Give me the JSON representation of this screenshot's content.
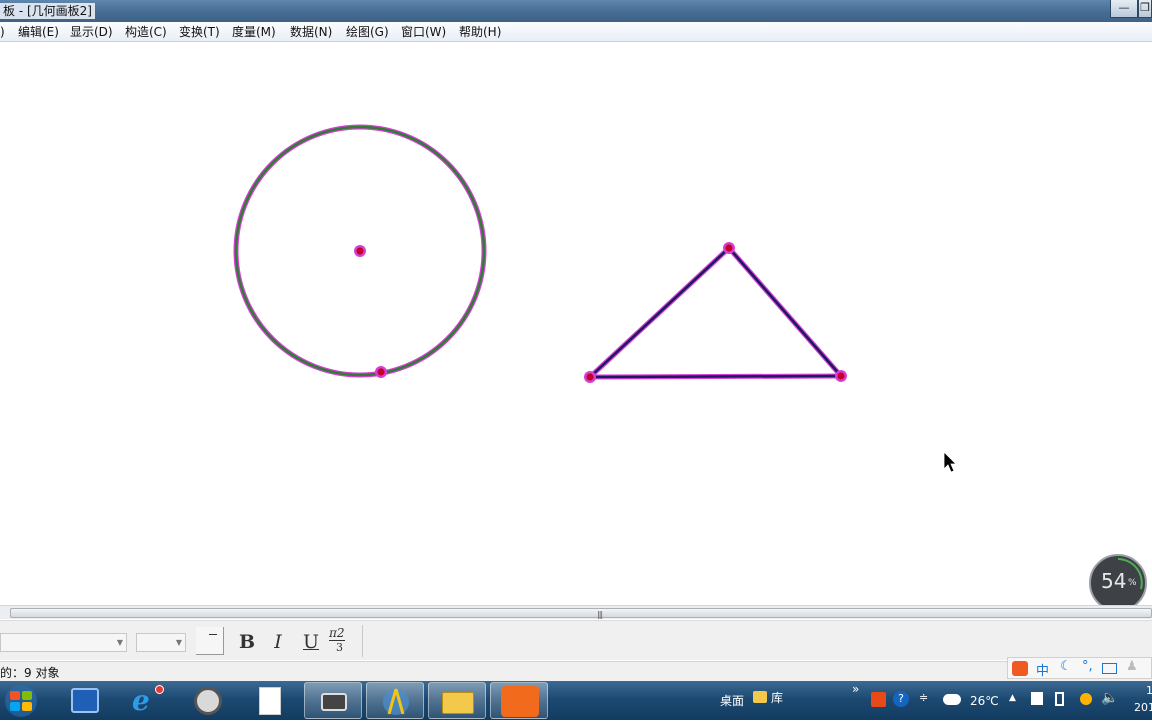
{
  "window": {
    "title": "板 - [几何画板2]",
    "min_label": "—",
    "max_label": "❐"
  },
  "menu": [
    {
      "label": ")"
    },
    {
      "label": "编辑(E)"
    },
    {
      "label": "显示(D)"
    },
    {
      "label": "构造(C)"
    },
    {
      "label": "变换(T)"
    },
    {
      "label": "度量(M)"
    },
    {
      "label": "数据(N)"
    },
    {
      "label": "绘图(G)"
    },
    {
      "label": "窗口(W)"
    },
    {
      "label": "帮助(H)"
    }
  ],
  "drawing": {
    "circle_color": "#2e7d32",
    "triangle_color": "#1a1a5e",
    "select_color": "#d63fd6",
    "point_color": "#c40028"
  },
  "text_toolbar": {
    "bold": "B",
    "italic": "I",
    "underline": "U",
    "math_num": "π2",
    "math_den": "3"
  },
  "status": {
    "text": "的：9 对象"
  },
  "gauge": {
    "value": "54",
    "unit": "%"
  },
  "ime": {
    "mode": "中"
  },
  "taskbar": {
    "desktop_label": "桌面",
    "library_label": "库",
    "chevron": "»",
    "temperature": "26℃",
    "clock_top": "1",
    "clock_bottom": "201"
  }
}
